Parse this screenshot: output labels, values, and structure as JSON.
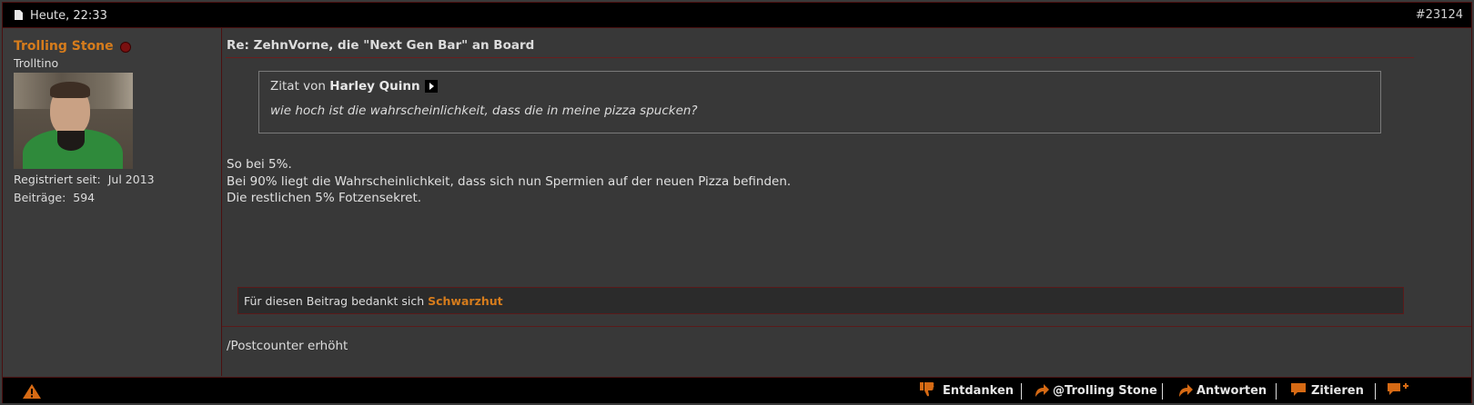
{
  "post": {
    "date": "Heute, 22:33",
    "number": "#23124",
    "title": "Re: ZehnVorne, die \"Next Gen Bar\" an Board"
  },
  "user": {
    "name": "Trolling Stone",
    "rank": "Trolltino",
    "registered_label": "Registriert seit:",
    "registered_value": "Jul 2013",
    "posts_label": "Beiträge:",
    "posts_value": "594"
  },
  "quote": {
    "prefix": "Zitat von",
    "author": "Harley Quinn",
    "text": "wie hoch ist die wahrscheinlichkeit, dass die in meine pizza spucken?"
  },
  "body_lines": [
    "So bei 5%.",
    "Bei 90% liegt die Wahrscheinlichkeit, dass sich nun Spermien auf der neuen Pizza befinden.",
    "Die restlichen 5% Fotzensekret."
  ],
  "thanks": {
    "prefix": "Für diesen Beitrag bedankt sich",
    "user": "Schwarzhut"
  },
  "signature": "/Postcounter erhöht",
  "footer": {
    "unthank": "Entdanken",
    "mention": "@Trolling Stone",
    "reply": "Antworten",
    "quote": "Zitieren"
  },
  "colors": {
    "accent": "#d67c1c",
    "border": "#4a1010"
  }
}
